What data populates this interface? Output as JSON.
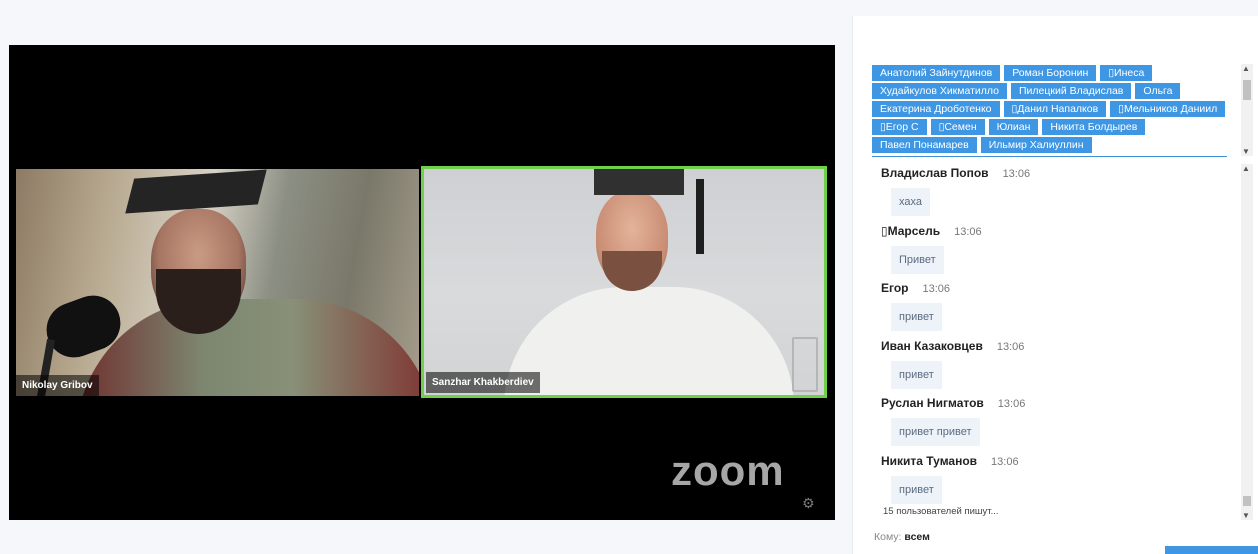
{
  "video": {
    "participants": [
      {
        "name": "Nikolay Gribov"
      },
      {
        "name": "Sanzhar Khakberdiev"
      }
    ],
    "logo": "zoom",
    "settings_icon": "gear-icon",
    "active_speaker_color": "#6fd04a"
  },
  "chat": {
    "participants": [
      "Анатолий Зайнутдинов",
      "Роман Боронин",
      "▯Инеса",
      "Худайкулов Хикматилло",
      "Пилецкий Владислав",
      "Ольга",
      "Екатерина Дроботенко",
      "▯Данил Напалков",
      "▯Мельников Даниил",
      "▯Егор С",
      "▯Семен",
      "Юлиан",
      "Никита Болдырев",
      "Павел Понамарев",
      "Ильмир Халиуллин"
    ],
    "messages": [
      {
        "author": "Владислав Попов",
        "time": "13:06",
        "text": "хаха"
      },
      {
        "author": "▯Марсель",
        "time": "13:06",
        "text": "Привет"
      },
      {
        "author": "Егор",
        "time": "13:06",
        "text": "привет"
      },
      {
        "author": "Иван Казаковцев",
        "time": "13:06",
        "text": "привет"
      },
      {
        "author": "Руслан Нигматов",
        "time": "13:06",
        "text": "привет привет"
      },
      {
        "author": "Никита Туманов",
        "time": "13:06",
        "text": "привет"
      }
    ],
    "typing_status": "15 пользователей пишут...",
    "recipient_label": "Кому:",
    "recipient_value": "всем",
    "accent_color": "#3f96e3"
  }
}
